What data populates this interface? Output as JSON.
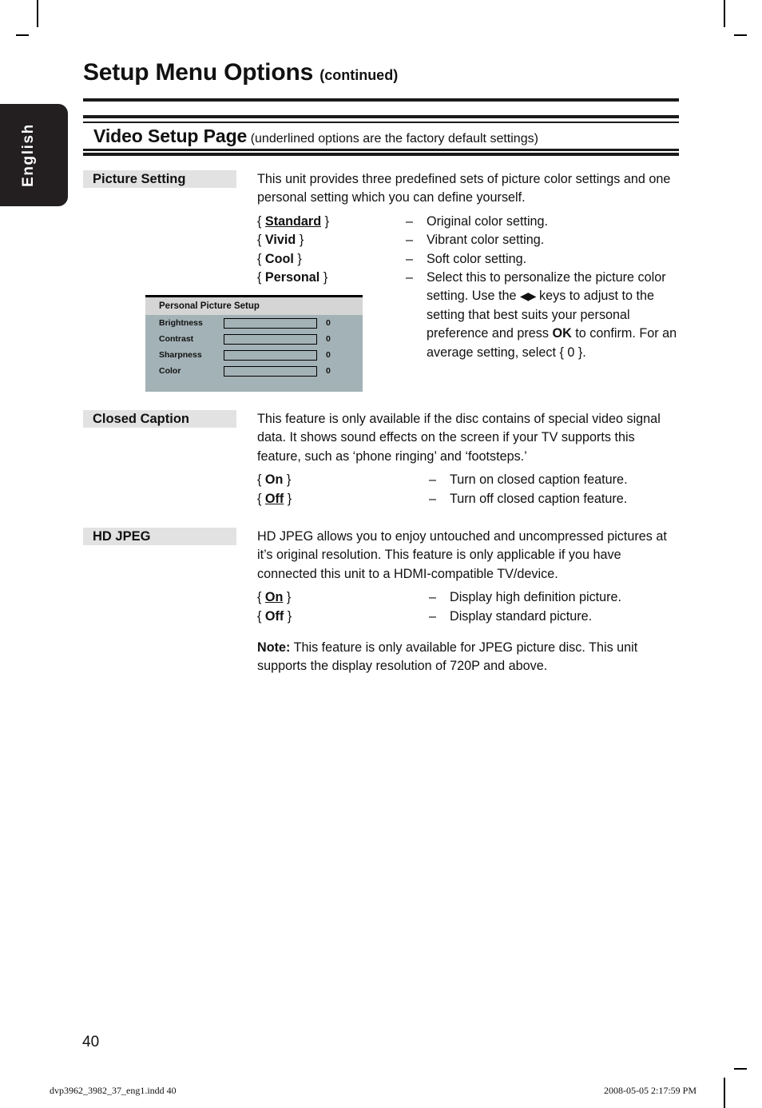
{
  "language_tab": {
    "label": "English"
  },
  "header": {
    "title": "Setup Menu Options",
    "title_suffix": "(continued)",
    "subtitle": "Video Setup Page",
    "subtitle_note": "(underlined options are the factory default settings)"
  },
  "sections": [
    {
      "label": "Picture Setting",
      "intro": "This unit provides three predefined sets of picture color settings and one personal setting which you can define yourself.",
      "options": [
        {
          "open": "{",
          "value": "Standard",
          "close": "}",
          "default": true,
          "dash": "–",
          "desc": "Original color setting."
        },
        {
          "open": "{",
          "value": "Vivid",
          "close": "}",
          "default": false,
          "dash": "–",
          "desc": "Vibrant color setting."
        },
        {
          "open": "{",
          "value": "Cool",
          "close": "}",
          "default": false,
          "dash": "–",
          "desc": "Soft color setting."
        },
        {
          "open": "{",
          "value": "Personal",
          "close": "}",
          "default": false,
          "dash": "–",
          "desc_part1": "Select this to personalize the picture color setting. Use the ",
          "desc_arrows": "◀▶",
          "desc_part2": " keys to adjust to the setting that best suits your personal preference and press ",
          "desc_ok": "OK",
          "desc_part3": " to confirm. For an average setting, select { 0 }."
        }
      ]
    },
    {
      "label": "Closed Caption",
      "intro": "This feature is only available if the disc contains of special video signal data. It shows sound effects on the screen if your TV supports this feature, such as ‘phone ringing’ and ‘footsteps.’",
      "options": [
        {
          "open": "{",
          "value": "On",
          "close": "}",
          "default": false,
          "dash": "–",
          "desc": "Turn on closed caption feature."
        },
        {
          "open": "{",
          "value": "Off",
          "close": "}",
          "default": true,
          "dash": "–",
          "desc": "Turn off closed caption feature."
        }
      ]
    },
    {
      "label": "HD JPEG",
      "intro": "HD JPEG allows you to enjoy untouched and uncompressed pictures at it’s original resolution. This feature is only applicable if you have connected this unit to a HDMI-compatible TV/device.",
      "options": [
        {
          "open": "{",
          "value": "On",
          "close": "}",
          "default": true,
          "dash": "–",
          "desc": "Display high definition picture."
        },
        {
          "open": "{",
          "value": "Off",
          "close": "}",
          "default": false,
          "dash": "–",
          "desc": "Display standard picture."
        }
      ],
      "note_label": "Note:",
      "note_text": "This feature is only available for JPEG picture disc. This unit supports the display resolution of 720P and above."
    }
  ],
  "osd_panel": {
    "title": "Personal Picture Setup",
    "rows": [
      {
        "name": "Brightness",
        "value": "0",
        "fill_percent": 55,
        "style": "light"
      },
      {
        "name": "Contrast",
        "value": "0",
        "fill_percent": 55,
        "style": "dark"
      },
      {
        "name": "Sharpness",
        "value": "0",
        "fill_percent": 55,
        "style": "dark"
      },
      {
        "name": "Color",
        "value": "0",
        "fill_percent": 55,
        "style": "dark"
      }
    ]
  },
  "footer": {
    "page_number": "40",
    "file_name": "dvp3962_3982_37_eng1.indd   40",
    "timestamp": "2008-05-05   2:17:59 PM"
  },
  "colors": {
    "tab_background": "#231f20",
    "label_chip": "#e2e2e2",
    "osd_body": "#a3b2b6",
    "osd_header": "#d5d5d5",
    "rule": "#1a1a1a"
  }
}
